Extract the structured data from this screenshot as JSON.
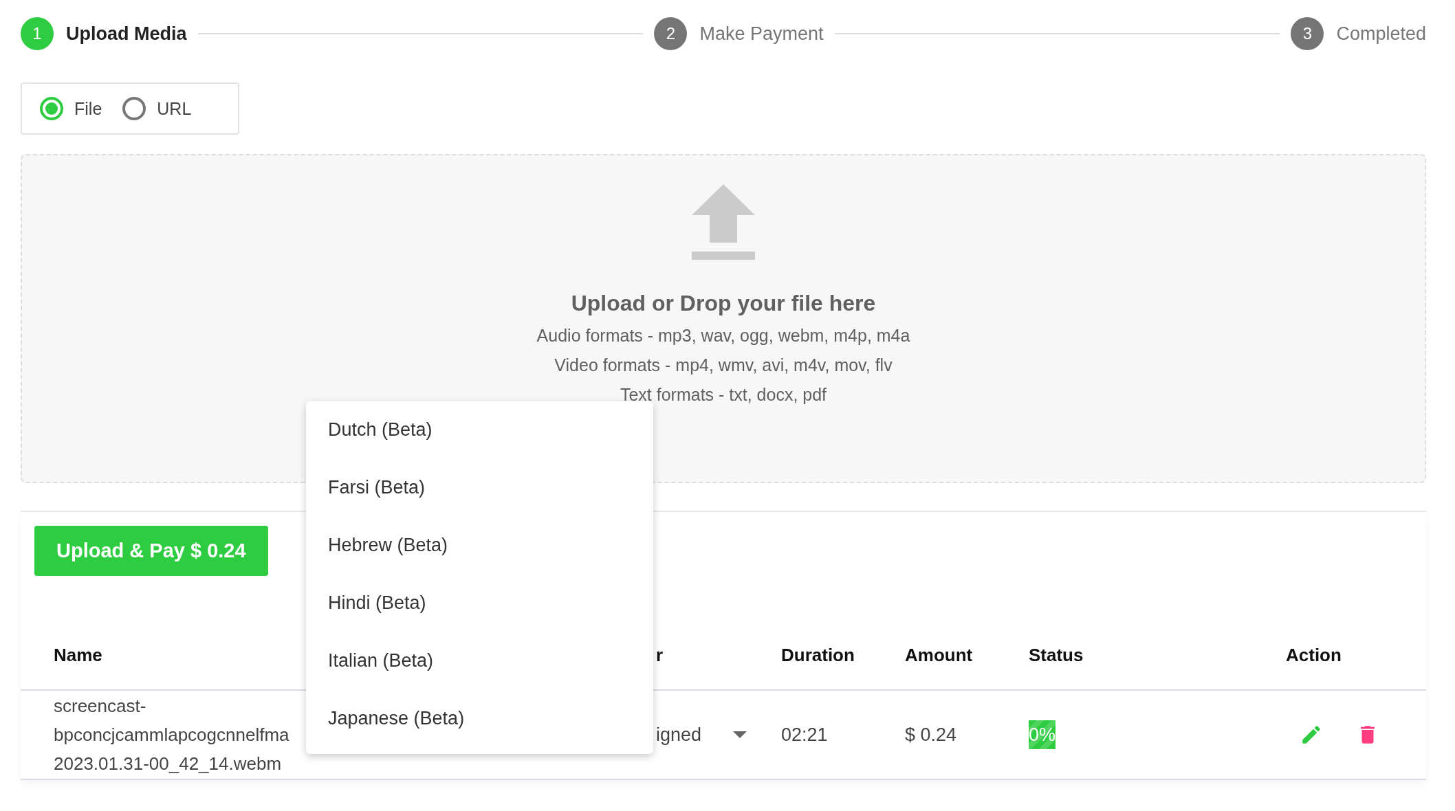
{
  "steps": [
    {
      "number": "1",
      "label": "Upload Media",
      "selected": true
    },
    {
      "number": "2",
      "label": "Make Payment",
      "selected": false
    },
    {
      "number": "3",
      "label": "Completed",
      "selected": false
    }
  ],
  "source_options": [
    {
      "label": "File",
      "selected": true
    },
    {
      "label": "URL",
      "selected": false
    }
  ],
  "drop_zone": {
    "title": "Upload or Drop your file here",
    "lines": [
      "Audio formats - mp3, wav, ogg, webm, m4p, m4a",
      "Video formats - mp4, wmv, avi, m4v, mov, flv",
      "Text formats - txt, docx, pdf"
    ]
  },
  "pay_button": "Upload & Pay $ 0.24",
  "table": {
    "columns": [
      "Name",
      "r",
      "Duration",
      "Amount",
      "Status",
      "Action"
    ],
    "rows": [
      {
        "name_lines": [
          "screencast-",
          "bpconcjcammlapcogcnnelfma",
          "2023.01.31-00_42_14.webm"
        ],
        "column_2": "igned",
        "duration": "02:21",
        "amount": "$ 0.24",
        "status": "0%"
      }
    ]
  },
  "language_menu": [
    {
      "label": "Dutch (Beta)",
      "selected": false
    },
    {
      "label": "Farsi (Beta)",
      "selected": false
    },
    {
      "label": "Hebrew (Beta)",
      "selected": false
    },
    {
      "label": "Hindi (Beta)",
      "selected": false
    },
    {
      "label": "Italian (Beta)",
      "selected": false
    },
    {
      "label": "Japanese (Beta)",
      "selected": false
    }
  ]
}
